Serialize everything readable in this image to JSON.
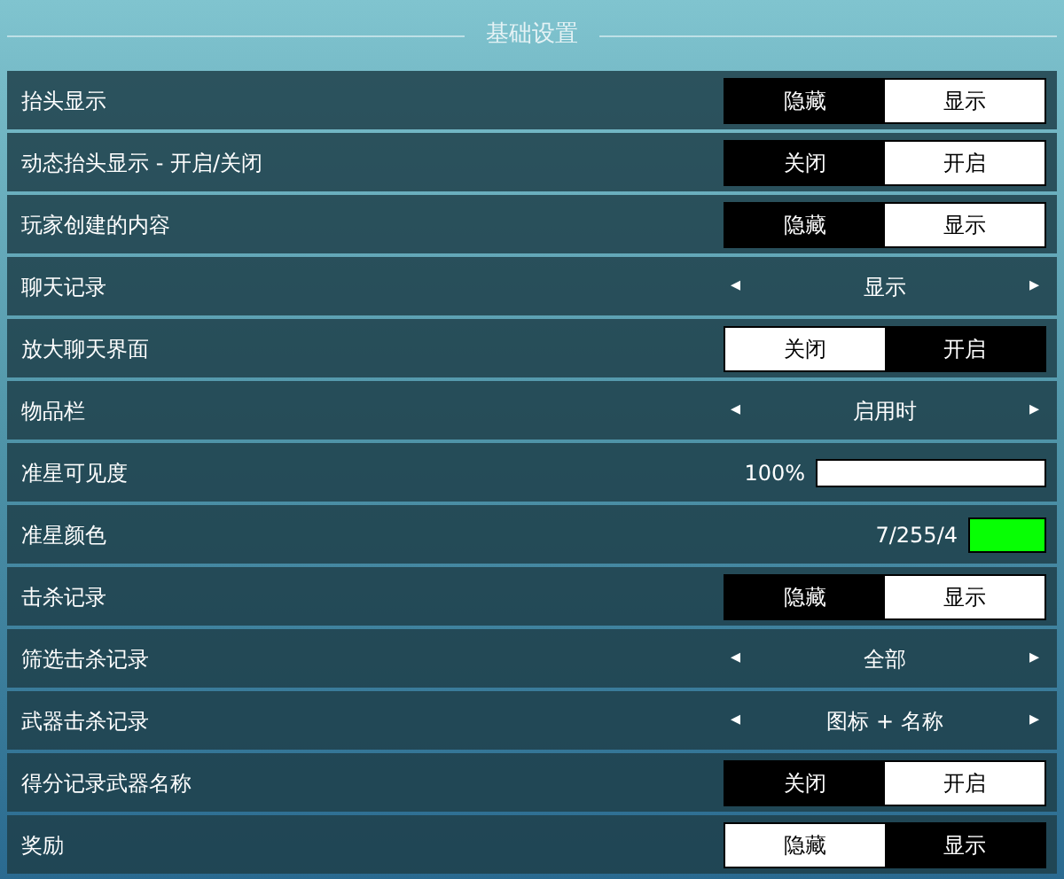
{
  "section_title": "基础设置",
  "rows": [
    {
      "kind": "toggle",
      "label": "抬头显示",
      "options": [
        {
          "label": "隐藏",
          "selected": false
        },
        {
          "label": "显示",
          "selected": true
        }
      ]
    },
    {
      "kind": "toggle",
      "label": "动态抬头显示 - 开启/关闭",
      "options": [
        {
          "label": "关闭",
          "selected": false
        },
        {
          "label": "开启",
          "selected": true
        }
      ]
    },
    {
      "kind": "toggle",
      "label": "玩家创建的内容",
      "options": [
        {
          "label": "隐藏",
          "selected": false
        },
        {
          "label": "显示",
          "selected": true
        }
      ]
    },
    {
      "kind": "selector",
      "label": "聊天记录",
      "value": "显示",
      "prev": "◂",
      "next": "▸"
    },
    {
      "kind": "toggle",
      "label": "放大聊天界面",
      "options": [
        {
          "label": "关闭",
          "selected": true
        },
        {
          "label": "开启",
          "selected": false
        }
      ]
    },
    {
      "kind": "selector",
      "label": "物品栏",
      "value": "启用时",
      "prev": "◂",
      "next": "▸"
    },
    {
      "kind": "slider",
      "label": "准星可见度",
      "reading": "100%",
      "level": 1
    },
    {
      "kind": "color",
      "label": "准星颜色",
      "reading": "7/255/4",
      "color": "#07ff04"
    },
    {
      "kind": "toggle",
      "label": "击杀记录",
      "options": [
        {
          "label": "隐藏",
          "selected": false
        },
        {
          "label": "显示",
          "selected": true
        }
      ]
    },
    {
      "kind": "selector",
      "label": "筛选击杀记录",
      "value": "全部",
      "prev": "◂",
      "next": "▸"
    },
    {
      "kind": "selector",
      "label": "武器击杀记录",
      "value": "图标 + 名称",
      "prev": "◂",
      "next": "▸"
    },
    {
      "kind": "toggle",
      "label": "得分记录武器名称",
      "options": [
        {
          "label": "关闭",
          "selected": false
        },
        {
          "label": "开启",
          "selected": true
        }
      ]
    },
    {
      "kind": "toggle",
      "label": "奖励",
      "options": [
        {
          "label": "隐藏",
          "selected": true
        },
        {
          "label": "显示",
          "selected": false
        }
      ]
    }
  ]
}
